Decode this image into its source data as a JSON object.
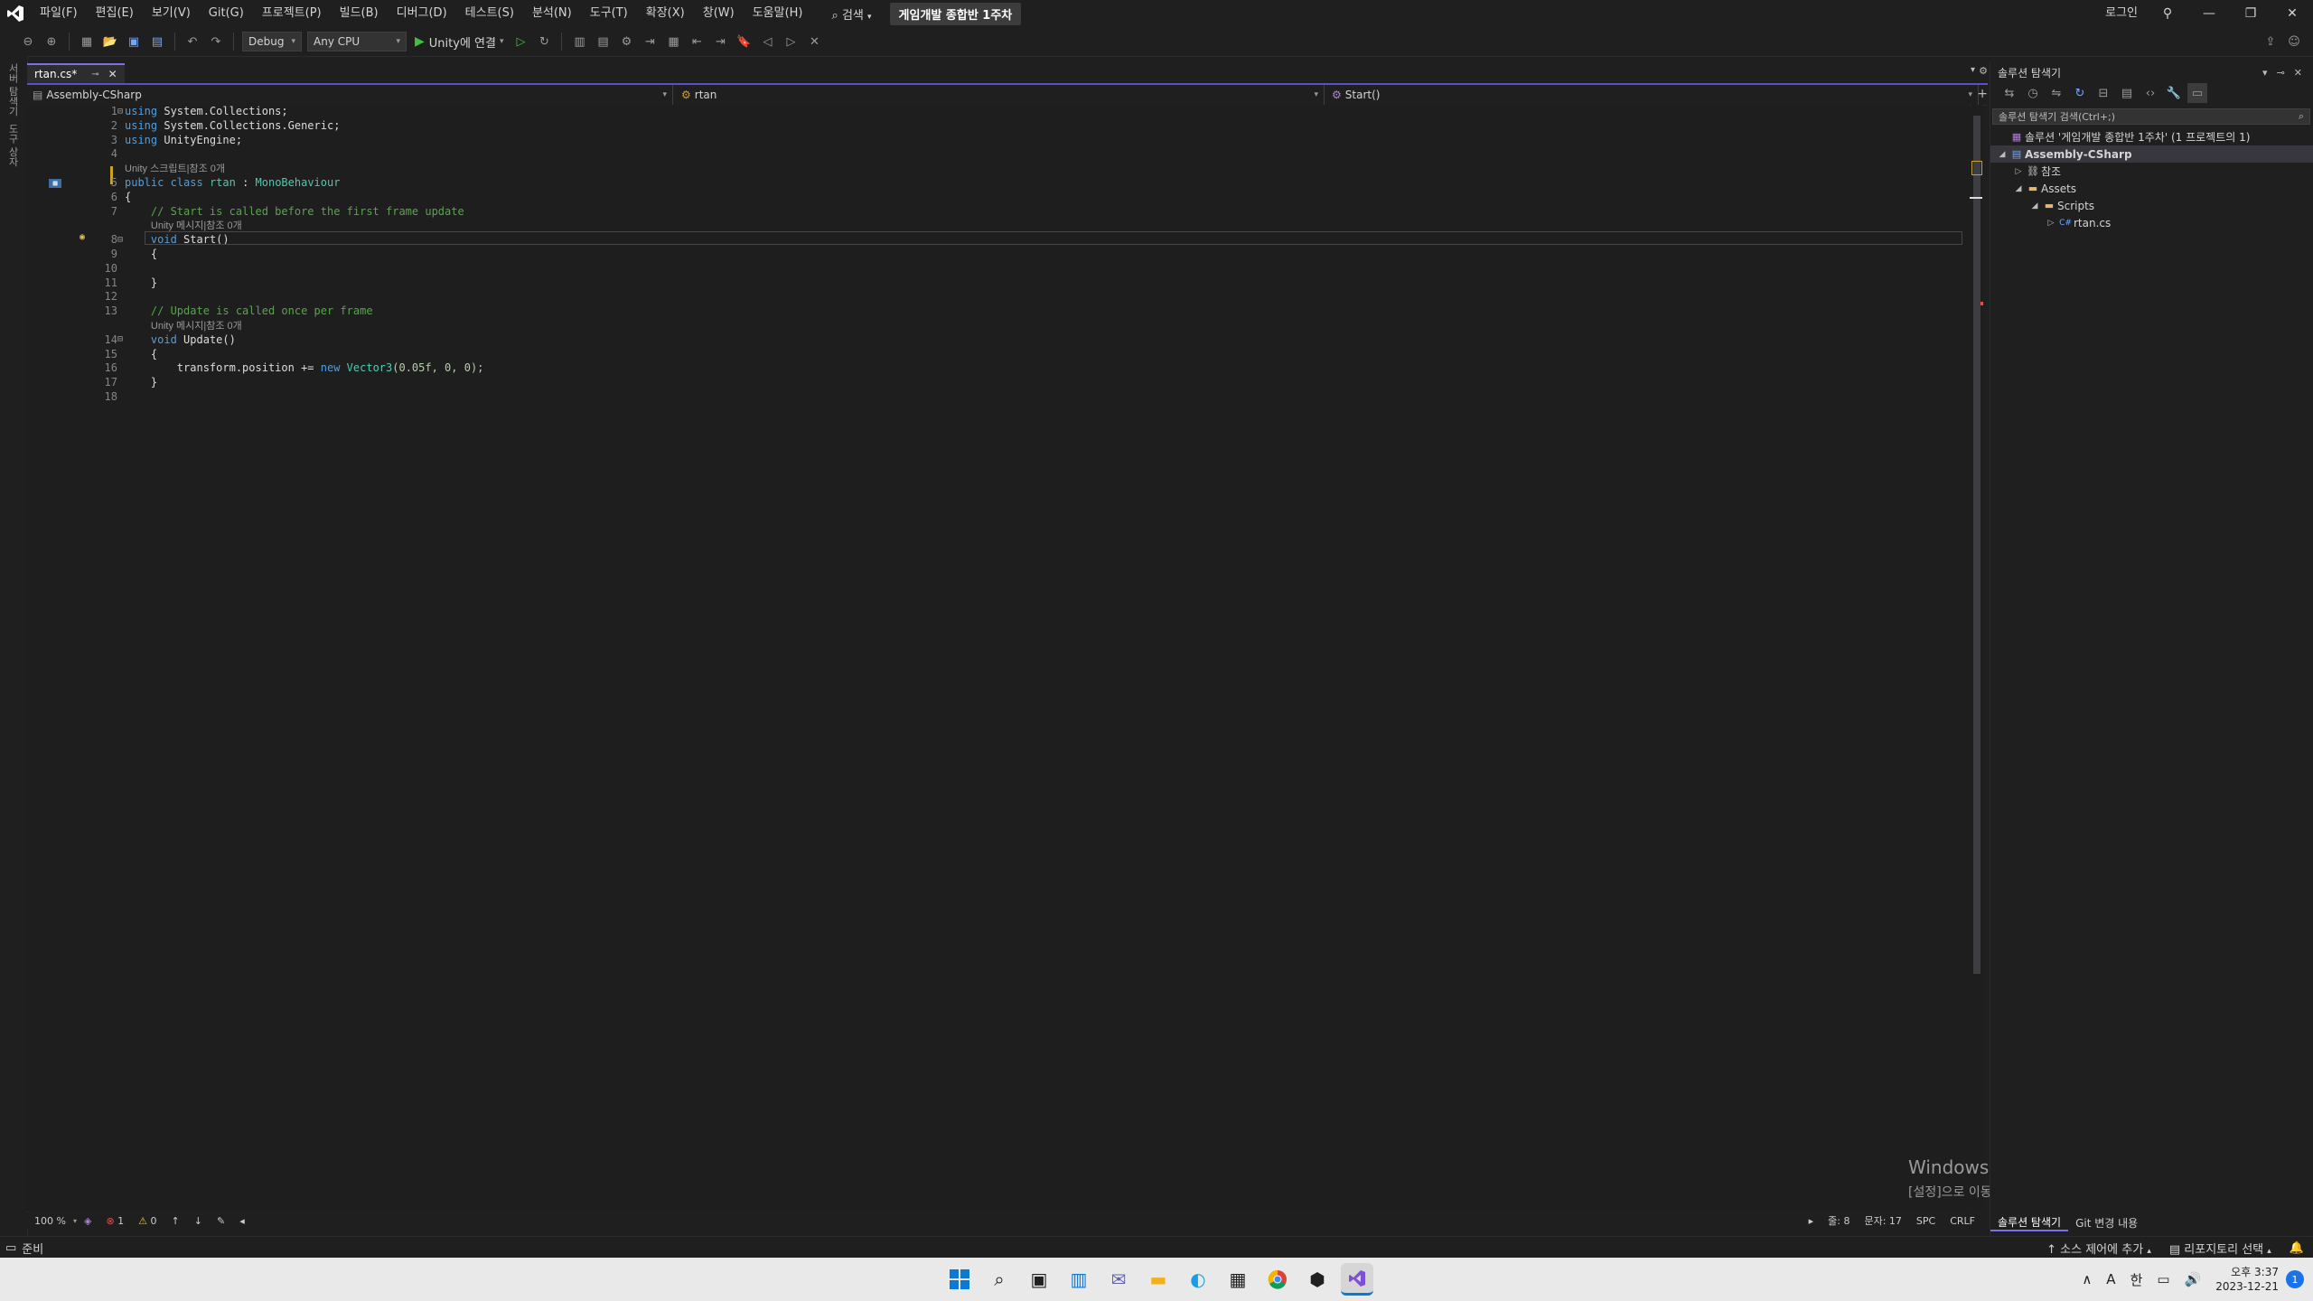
{
  "title_bar": {
    "menu": [
      "파일(F)",
      "편집(E)",
      "보기(V)",
      "Git(G)",
      "프로젝트(P)",
      "빌드(B)",
      "디버그(D)",
      "테스트(S)",
      "분석(N)",
      "도구(T)",
      "확장(X)",
      "창(W)",
      "도움말(H)"
    ],
    "search_label": "검색",
    "solution_name": "게임개발 종합반 1주차",
    "login_label": "로그인"
  },
  "toolbar": {
    "config": "Debug",
    "platform": "Any CPU",
    "run_label": "Unity에 연결"
  },
  "left_rail": [
    "서버 탐색기",
    "도구 상자"
  ],
  "document_tab": {
    "label": "rtan.cs*"
  },
  "navbar": {
    "project": "Assembly-CSharp",
    "class": "rtan",
    "member": "Start()"
  },
  "editor": {
    "line_numbers": [
      "1",
      "2",
      "3",
      "4",
      "",
      "5",
      "6",
      "7",
      "",
      "8",
      "9",
      "10",
      "11",
      "12",
      "13",
      "",
      "14",
      "15",
      "16",
      "17",
      "18"
    ],
    "codelens": {
      "class": "Unity 스크립트|참조 0개",
      "start": "Unity 메시지|참조 0개",
      "update": "Unity 메시지|참조 0개"
    },
    "code": {
      "l1": "System.Collections;",
      "l2": "System.Collections.Generic;",
      "l3": "UnityEngine;",
      "using": "using",
      "public_class": "public class",
      "class_name": "rtan",
      "base_sep": " : ",
      "base": "MonoBehaviour",
      "open": "{",
      "close": "}",
      "c_start": "// Start is called before the first frame update",
      "void": "void",
      "start_sig": "Start()",
      "c_update": "// Update is called once per frame",
      "update_sig": "Update()",
      "l16_a": "transform.position += ",
      "new": "new",
      "vector": "Vector3",
      "l16_b": "(0.05f, 0, 0);"
    }
  },
  "editor_status": {
    "zoom": "100 %",
    "errors": "1",
    "warnings": "0",
    "line": "줄: 8",
    "col": "문자: 17",
    "spc": "SPC",
    "crlf": "CRLF"
  },
  "watermark": {
    "title": "Windows 정품 인증",
    "subtitle": "[설정]으로 이동하여 Windows를 정품 인증합니다."
  },
  "solution_explorer": {
    "title": "솔루션 탐색기",
    "search_placeholder": "솔루션 탐색기 검색(Ctrl+;)",
    "tree": {
      "solution": "솔루션 '게임개발 종합반 1주차' (1 프로젝트의 1)",
      "project": "Assembly-CSharp",
      "references": "참조",
      "assets": "Assets",
      "scripts": "Scripts",
      "file": "rtan.cs"
    },
    "tabs": [
      "솔루션 탐색기",
      "Git 변경 내용"
    ]
  },
  "status_bar": {
    "ready": "준비",
    "source_control": "소스 제어에 추가",
    "repository": "리포지토리 선택"
  },
  "taskbar": {
    "ime": "A",
    "lang": "한",
    "time": "오후 3:37",
    "date": "2023-12-21",
    "notifications": "1"
  },
  "colors": {
    "accent": "#7b6ef0",
    "keyword": "#569cd6",
    "type": "#4ec9b0",
    "comment": "#57a64a"
  }
}
